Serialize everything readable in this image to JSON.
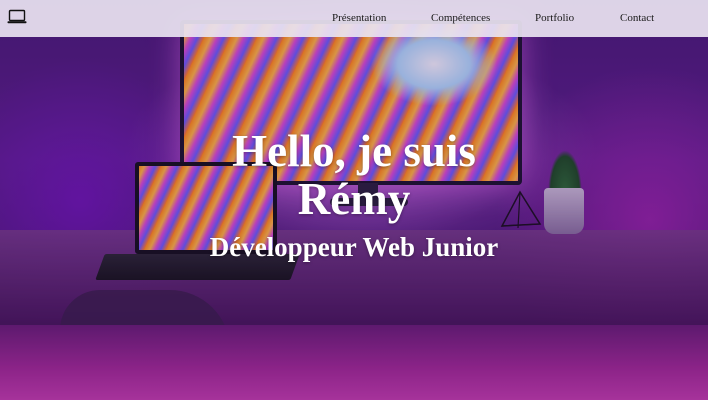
{
  "navbar": {
    "logo_icon": "laptop-icon",
    "links": [
      {
        "label": "Présentation"
      },
      {
        "label": "Compétences"
      },
      {
        "label": "Portfolio"
      },
      {
        "label": "Contact"
      }
    ]
  },
  "hero": {
    "title_line1": "Hello, je suis",
    "title_line2": "Rémy",
    "subtitle": "Développeur Web Junior"
  },
  "colors": {
    "navbar_background": "#e8e2f0",
    "hero_text": "#ffffff",
    "nav_text": "#1a1a1a"
  }
}
